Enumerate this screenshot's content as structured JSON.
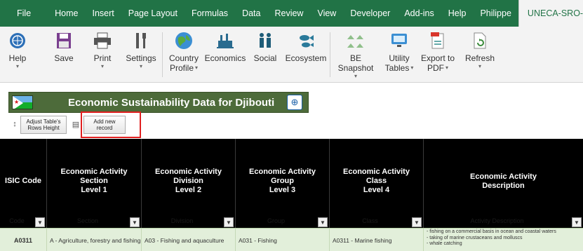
{
  "tabs": [
    "File",
    "Home",
    "Insert",
    "Page Layout",
    "Formulas",
    "Data",
    "Review",
    "View",
    "Developer",
    "Add-ins",
    "Help",
    "Philippe",
    "UNECA-SRO-EA"
  ],
  "ribbon": {
    "help": {
      "label": "Help",
      "icon": "un-emblem-icon"
    },
    "save": {
      "label": "Save",
      "icon": "floppy-disk-icon"
    },
    "print": {
      "label": "Print",
      "icon": "printer-icon"
    },
    "settings": {
      "label": "Settings",
      "icon": "tools-icon"
    },
    "country_profile": {
      "label1": "Country",
      "label2": "Profile",
      "icon": "globe-icon"
    },
    "economics": {
      "label": "Economics",
      "icon": "factory-icon"
    },
    "social": {
      "label": "Social",
      "icon": "people-icon"
    },
    "ecosystem": {
      "label": "Ecosystem",
      "icon": "fish-icon"
    },
    "be_snapshot": {
      "label": "BE Snapshot",
      "icon": "cluster-icon"
    },
    "utility_tables": {
      "label1": "Utility",
      "label2": "Tables",
      "icon": "monitor-icon"
    },
    "export_pdf": {
      "label1": "Export to",
      "label2": "PDF",
      "icon": "pdf-icon"
    },
    "refresh": {
      "label": "Refresh",
      "icon": "refresh-icon"
    }
  },
  "sheet": {
    "banner_title": "Economic Sustainability Data for Djibouti",
    "adjust_button": "Adjust Table's\nRows Height",
    "add_button": "Add new\nrecord"
  },
  "table": {
    "headers": [
      {
        "label": "ISIC Code",
        "ghost": "Code"
      },
      {
        "label": "Economic Activity\nSection\nLevel 1",
        "ghost": "Section"
      },
      {
        "label": "Economic Activity\nDivision\nLevel 2",
        "ghost": "Division"
      },
      {
        "label": "Economic Activity\nGroup\nLevel 3",
        "ghost": "Group"
      },
      {
        "label": "Economic Activity\nClass\nLevel 4",
        "ghost": "Class"
      },
      {
        "label": "Economic Activity\nDescription",
        "ghost": "Activity Description"
      }
    ],
    "row": {
      "code": "A0311",
      "section": "A - Agriculture, forestry and fishing",
      "division": "A03 - Fishing and aquaculture",
      "group": "A031 - Fishing",
      "class": "A0311 - Marine fishing",
      "desc1": "- fishing on a commercial basis in ocean and coastal waters",
      "desc2": "- taking of marine crustaceans and molluscs",
      "desc3": "- whale catching"
    }
  },
  "colors": {
    "ribbon_green": "#217346",
    "banner_green": "#4d6b3a",
    "row_green": "#e2efda",
    "highlight_red": "#e02020"
  }
}
